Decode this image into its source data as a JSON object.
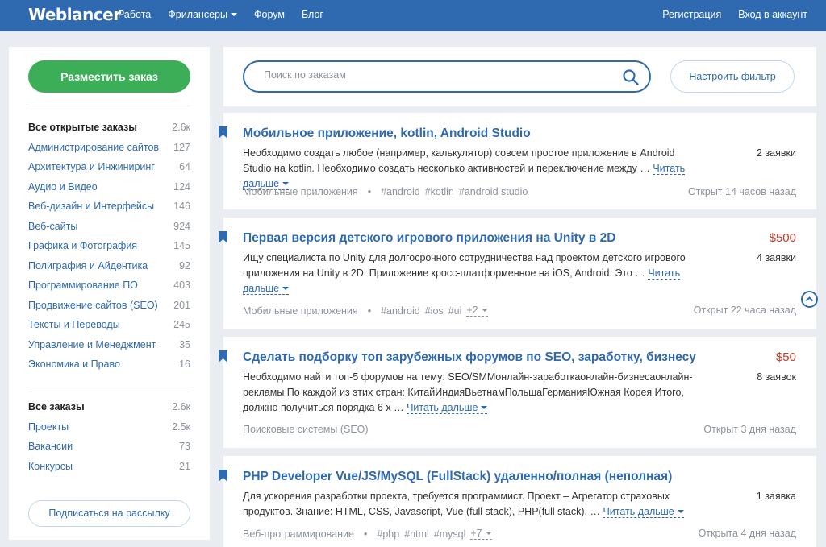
{
  "header": {
    "logo": "Weblancer",
    "nav": [
      {
        "label": "Работа"
      },
      {
        "label": "Фрилансеры"
      },
      {
        "label": "Форум"
      },
      {
        "label": "Блог"
      }
    ],
    "register": "Регистрация",
    "login": "Вход в аккаунт"
  },
  "sidebar": {
    "post_button": "Разместить заказ",
    "open_orders": {
      "title": "Все открытые заказы",
      "count": "2.6к",
      "items": [
        {
          "label": "Администрирование сайтов",
          "count": "127"
        },
        {
          "label": "Архитектура и Инжиниринг",
          "count": "64"
        },
        {
          "label": "Аудио и Видео",
          "count": "124"
        },
        {
          "label": "Веб-дизайн и Интерфейсы",
          "count": "146"
        },
        {
          "label": "Веб-сайты",
          "count": "924"
        },
        {
          "label": "Графика и Фотография",
          "count": "145"
        },
        {
          "label": "Полиграфия и Айдентика",
          "count": "92"
        },
        {
          "label": "Программирование ПО",
          "count": "403"
        },
        {
          "label": "Продвижение сайтов (SEO)",
          "count": "201"
        },
        {
          "label": "Тексты и Переводы",
          "count": "245"
        },
        {
          "label": "Управление и Менеджмент",
          "count": "35"
        },
        {
          "label": "Экономика и Право",
          "count": "16"
        }
      ]
    },
    "all_orders": {
      "title": "Все заказы",
      "count": "2.6к",
      "items": [
        {
          "label": "Проекты",
          "count": "2.5к"
        },
        {
          "label": "Вакансии",
          "count": "73"
        },
        {
          "label": "Конкурсы",
          "count": "21"
        }
      ]
    },
    "subscribe_button": "Подписаться на рассылку"
  },
  "search": {
    "placeholder": "Поиск по заказам",
    "filter_button": "Настроить фильтр"
  },
  "read_more": "Читать дальше",
  "orders": [
    {
      "title": "Мобильное приложение, kotlin, Android Studio",
      "description": "Необходимо создать любое (например, калькулятор) совсем простое приложение в Android Studio на kotlin. Необходимо создать несколько активностей и переключение между …",
      "price": "",
      "bids": "2 заявки",
      "category": "Мобильные приложения",
      "tags": [
        "#android",
        "#kotlin",
        "#android studio"
      ],
      "tags_more": "",
      "time": "Открыт 14 часов назад"
    },
    {
      "title": "Первая версия детского игрового приложения на Unity в 2D",
      "description": "Ищу специалиста по Unity для долгосрочного сотрудничества над проектом детского игрового приложения на Unity в 2D. Приложение кросс-платформенное на iOS, Android. Это …",
      "price": "$500",
      "bids": "4 заявки",
      "category": "Мобильные приложения",
      "tags": [
        "#android",
        "#ios",
        "#ui"
      ],
      "tags_more": "+2",
      "time": "Открыт 22 часа назад"
    },
    {
      "title": "Сделать подборку топ зарубежных форумов по SEO, заработку, бизнесу",
      "description": "Необходимо найти топ-5 форумов на тему: SEO/SMMонлайн-заработкаонлайн-бизнесаонлайн-рекламы По каждой из этих стран: КитайИндияВьетнамПольшаГерманияЮжная Корея Итого, должно получиться порядка 6 х …",
      "price": "$50",
      "bids": "8 заявок",
      "category": "Поисковые системы (SEO)",
      "tags": [],
      "tags_more": "",
      "time": "Открыт 3 дня назад"
    },
    {
      "title": "PHP Developer Vue/JS/MySQL (FullStack) удаленно/полная (неполная)",
      "description": "Для ускорения разработки проекта, требуется программист. Проект – Агрегатор страховых продуктов. Знание: HTML, CSS, Javascript, Vue (full stack), PHP(full stack), …",
      "price": "",
      "bids": "1 заявка",
      "category": "Веб-программирование",
      "tags": [
        "#php",
        "#html",
        "#mysql"
      ],
      "tags_more": "+7",
      "time": "Открыта 4 дня назад"
    }
  ],
  "colors": {
    "brand": "#2f6ab0",
    "accent_green": "#3dae58",
    "price_red": "#c0392b",
    "muted": "#8c939b",
    "page_bg": "#e9edf2"
  },
  "icons": [
    "search-icon",
    "bookmark-icon",
    "chevron-down-icon",
    "scroll-top-icon"
  ]
}
